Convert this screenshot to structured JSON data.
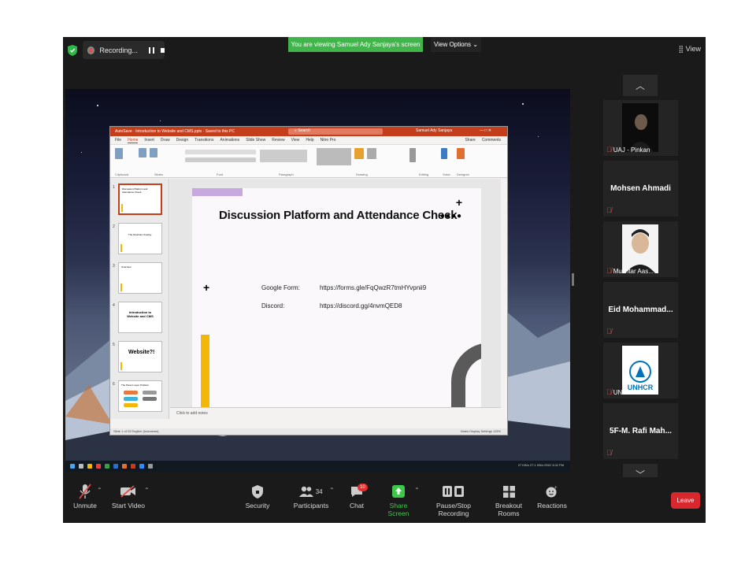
{
  "top": {
    "recording_label": "Recording...",
    "viewing_banner": "You are viewing Samuel Ady Sanjaya's screen",
    "view_options_label": "View Options",
    "view_label": "View"
  },
  "ppt": {
    "title_bar": "AutoSave  ·  Introduction to Website and CMS.pptx  ·  Saved to this PC",
    "search_placeholder": "Search",
    "user": "Samuel Ady Sanjaya",
    "menu": [
      "File",
      "Home",
      "Insert",
      "Draw",
      "Design",
      "Transitions",
      "Animations",
      "Slide Show",
      "Review",
      "View",
      "Help",
      "Nitro Pro"
    ],
    "share_label": "Share",
    "comments_label": "Comments",
    "ribbon_groups": [
      "Clipboard",
      "Slides",
      "Font",
      "Paragraph",
      "Drawing",
      "Editing",
      "Voice",
      "Designer"
    ],
    "slide": {
      "title": "Discussion Platform and Attendance Check",
      "rows": [
        {
          "label": "Google Form:",
          "value": "https://forms.gle/FqQwzR7tmHYvpnii9"
        },
        {
          "label": "Discord:",
          "value": "https://discord.gg/4nvmQED8"
        }
      ]
    },
    "thumb_numbers": [
      "1",
      "2",
      "3",
      "4",
      "5",
      "6"
    ],
    "thumb_texts": [
      "Discussion Platform and Attendance Check",
      "The Structure Overlay",
      "Overview",
      "Introduction to Website and CMS",
      "Website?!",
      "The Parent Layer Problem"
    ],
    "notes_placeholder": "Click to add notes",
    "status_text": "Slide 1 of 23    English (Indonesia)",
    "status_right": "Notes    Display Settings    115%",
    "tray_text": "27 KB/s  27.1 KB/s  ENG  3:02 PM"
  },
  "participants": [
    {
      "name": "UAJ - Pinkan",
      "type": "photo"
    },
    {
      "name": "Mohsen Ahmadi",
      "type": "name"
    },
    {
      "name": "Mukhtar Aas...",
      "type": "photo"
    },
    {
      "name": "Eid  Mohammad...",
      "type": "name"
    },
    {
      "name": "UNHCR Indo...",
      "type": "logo",
      "logo_text": "UNHCR"
    },
    {
      "name": "5F-M. Rafi Mah...",
      "type": "name"
    }
  ],
  "toolbar": {
    "unmute": "Unmute",
    "start_video": "Start Video",
    "security": "Security",
    "participants": "Participants",
    "participants_count": "34",
    "chat": "Chat",
    "chat_badge": "10",
    "share_screen": "Share Screen",
    "pause_recording": "Pause/Stop Recording",
    "breakout_rooms": "Breakout Rooms",
    "reactions": "Reactions",
    "leave": "Leave"
  },
  "colors": {
    "zoom_green": "#40b64a",
    "ppt_accent": "#c43e1c",
    "leave_red": "#d8272d",
    "slide_yellow": "#f3b70a",
    "slide_purple": "#c9a8e0"
  }
}
